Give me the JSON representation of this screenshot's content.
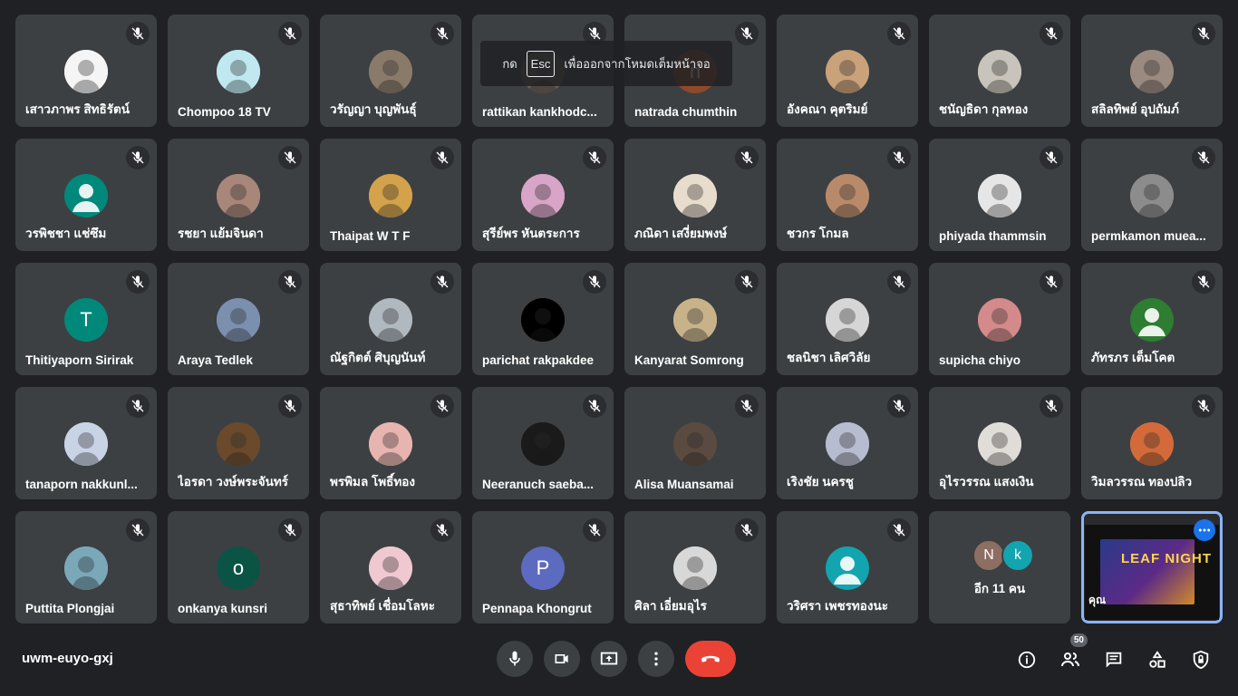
{
  "esc_banner": {
    "prefix": "กด",
    "key": "Esc",
    "suffix": "เพื่อออกจากโหมดเต็มหน้าจอ"
  },
  "participants": [
    {
      "name": "เสาวภาพร สิทธิรัตน์",
      "avatar": "photo",
      "color": "#f5f5f5"
    },
    {
      "name": "Chompoo 18 TV",
      "avatar": "photo",
      "color": "#bfe8f0"
    },
    {
      "name": "วรัญญา บุญพันธุ์",
      "avatar": "photo",
      "color": "#8a7a6a"
    },
    {
      "name": "rattikan kankhodc...",
      "avatar": "photo",
      "color": "#6b5d52"
    },
    {
      "name": "natrada chumthin",
      "avatar": "letter",
      "letter": "n",
      "color": "#8d4a2a"
    },
    {
      "name": "อังคณา คุตริมย์",
      "avatar": "photo",
      "color": "#c9a27a"
    },
    {
      "name": "ชนัญธิดา กุลทอง",
      "avatar": "photo",
      "color": "#c8c3bb"
    },
    {
      "name": "สลิลทิพย์ อุปถัมภ์",
      "avatar": "photo",
      "color": "#9a8a80"
    },
    {
      "name": "วรพิชชา แช่ซึม",
      "avatar": "default",
      "color": "#00897b"
    },
    {
      "name": "รชยา แย้มจินดา",
      "avatar": "photo",
      "color": "#a8867a"
    },
    {
      "name": "Thaipat W T F",
      "avatar": "photo",
      "color": "#d4a24a"
    },
    {
      "name": "สุรีย์พร หันตระการ",
      "avatar": "photo",
      "color": "#d8a4c8"
    },
    {
      "name": "ภณิดา เสงี่ยมพงษ์",
      "avatar": "photo",
      "color": "#e8dccd"
    },
    {
      "name": "ชวกร โกมล",
      "avatar": "photo",
      "color": "#b88a6a"
    },
    {
      "name": "phiyada thammsin",
      "avatar": "photo",
      "color": "#e6e6e6"
    },
    {
      "name": "permkamon muea...",
      "avatar": "photo",
      "color": "#8c8c8c"
    },
    {
      "name": "Thitiyaporn Sirirak",
      "avatar": "letter",
      "letter": "T",
      "color": "#00897b"
    },
    {
      "name": "Araya Tedlek",
      "avatar": "photo",
      "color": "#7b8fae"
    },
    {
      "name": "ณัฐกิตต์ ศิบุญนันท์",
      "avatar": "photo",
      "color": "#b0b8c0"
    },
    {
      "name": "parichat rakpakdee",
      "avatar": "photo",
      "color": "#000000"
    },
    {
      "name": "Kanyarat Somrong",
      "avatar": "photo",
      "color": "#c7b28a"
    },
    {
      "name": "ชลนิชา เลิศวิลัย",
      "avatar": "photo",
      "color": "#d6d6d6"
    },
    {
      "name": "supicha chiyo",
      "avatar": "photo",
      "color": "#d48a8a"
    },
    {
      "name": "ภัทรภร เต็มโคต",
      "avatar": "default",
      "color": "#2e7d32"
    },
    {
      "name": "tanaporn nakkunl...",
      "avatar": "photo",
      "color": "#c9d3e6"
    },
    {
      "name": "ไอรดา วงษ์พระจันทร์",
      "avatar": "photo",
      "color": "#6a4a2a"
    },
    {
      "name": "พรพิมล โพธิ์ทอง",
      "avatar": "photo",
      "color": "#e8b4b0"
    },
    {
      "name": "Neeranuch saeba...",
      "avatar": "photo",
      "color": "#1a1a1a"
    },
    {
      "name": "Alisa Muansamai",
      "avatar": "photo",
      "color": "#5a4a40"
    },
    {
      "name": "เริงชัย นครชู",
      "avatar": "photo",
      "color": "#b8bcd0"
    },
    {
      "name": "อุไรวรรณ แสงเงิน",
      "avatar": "photo",
      "color": "#e0dcd8"
    },
    {
      "name": "วิมลวรรณ ทองปลิว",
      "avatar": "photo",
      "color": "#d46a3a"
    },
    {
      "name": "Puttita Plongjai",
      "avatar": "photo",
      "color": "#7aa8b8"
    },
    {
      "name": "onkanya kunsri",
      "avatar": "letter",
      "letter": "o",
      "color": "#0b5345"
    },
    {
      "name": "สุธาทิพย์ เชื่อมโลหะ",
      "avatar": "photo",
      "color": "#f0c8d0"
    },
    {
      "name": "Pennapa Khongrut",
      "avatar": "letter",
      "letter": "P",
      "color": "#5c6bc0"
    },
    {
      "name": "ศิลา เอี่ยมอุไร",
      "avatar": "photo",
      "color": "#d8d8d8"
    },
    {
      "name": "วริศรา เพชรทองนะ",
      "avatar": "default",
      "color": "#12a4af"
    }
  ],
  "more_tile": {
    "letters": [
      "N",
      "k"
    ],
    "colors": [
      "#8d6e63",
      "#12a4af"
    ],
    "text": "อีก 11 คน"
  },
  "self_tile": {
    "name": "คุณ",
    "slide_text": "LEAF NIGHT"
  },
  "meeting_code": "uwm-euyo-gxj",
  "participant_count": "50",
  "icons": {
    "mic": "mic-icon",
    "camera": "camera-icon",
    "present": "present-screen-icon",
    "more": "more-vert-icon",
    "end": "end-call-icon",
    "info": "info-icon",
    "people": "people-icon",
    "chat": "chat-icon",
    "activities": "activities-icon",
    "host": "host-controls-icon"
  },
  "accent_color": "#8ab4f8",
  "end_call_color": "#ea4335"
}
